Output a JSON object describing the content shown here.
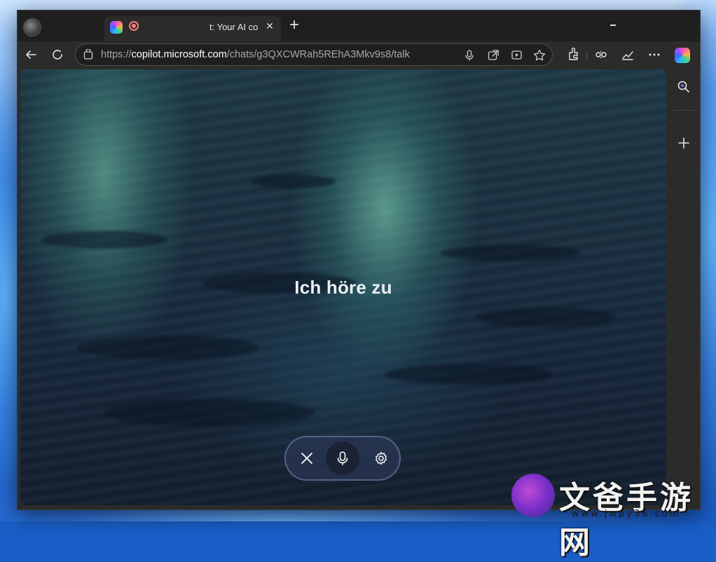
{
  "browser": {
    "tab": {
      "title": "t: Your AI co",
      "close_label": "✕"
    },
    "new_tab_label": "+",
    "address_bar": {
      "url_prefix": "https://",
      "url_host": "copilot.microsoft.com",
      "url_path": "/chats/g3QXCWRah5REhA3Mkv9s8/talk"
    }
  },
  "voice_session": {
    "status_text": "Ich höre zu"
  },
  "watermark": {
    "text": "文爸手游网",
    "url": "www.jwpy36.com"
  },
  "colors": {
    "accent": "#2fb7ff",
    "recording": "#ff7b7b",
    "background": "#1b2f40"
  }
}
